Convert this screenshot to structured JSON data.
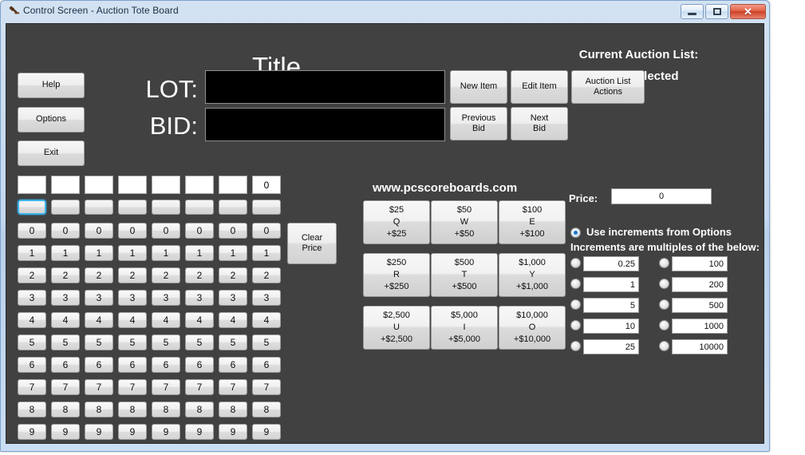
{
  "window": {
    "title": "Control Screen - Auction Tote Board",
    "icon": "gavel-icon",
    "minimize_label": "",
    "maximize_label": "",
    "close_label": "✕"
  },
  "header": {
    "app_title": "Title",
    "current_list_label": "Current Auction List:",
    "current_list_value": "none selected"
  },
  "left_buttons": [
    {
      "label": "Help",
      "name": "help-button"
    },
    {
      "label": "Options",
      "name": "options-button"
    },
    {
      "label": "Exit",
      "name": "exit-button"
    }
  ],
  "fields": {
    "lot_label": "LOT:",
    "lot_value": "",
    "bid_label": "BID:",
    "bid_value": ""
  },
  "item_buttons": [
    {
      "label": "New Item",
      "name": "new-item-button"
    },
    {
      "label": "Edit Item",
      "name": "edit-item-button"
    },
    {
      "label": "Auction List\nActions",
      "name": "auction-list-actions-button"
    },
    {
      "label": "Previous\nBid",
      "name": "previous-bid-button"
    },
    {
      "label": "Next\nBid",
      "name": "next-bid-button"
    }
  ],
  "keypad": {
    "columns": 8,
    "top_row_values": [
      "",
      "",
      "",
      "",
      "",
      "",
      "",
      "0"
    ],
    "blank_row_focused_index": 0,
    "digit_rows": [
      "0",
      "1",
      "2",
      "3",
      "4",
      "5",
      "6",
      "7",
      "8",
      "9"
    ],
    "clear_price_label": "Clear\nPrice"
  },
  "branding": {
    "website": "www.pcscoreboards.com"
  },
  "quick_amounts": [
    {
      "amount": "$25",
      "key": "Q",
      "delta": "+$25"
    },
    {
      "amount": "$50",
      "key": "W",
      "delta": "+$50"
    },
    {
      "amount": "$100",
      "key": "E",
      "delta": "+$100"
    },
    {
      "amount": "$250",
      "key": "R",
      "delta": "+$250"
    },
    {
      "amount": "$500",
      "key": "T",
      "delta": "+$500"
    },
    {
      "amount": "$1,000",
      "key": "Y",
      "delta": "+$1,000"
    },
    {
      "amount": "$2,500",
      "key": "U",
      "delta": "+$2,500"
    },
    {
      "amount": "$5,000",
      "key": "I",
      "delta": "+$5,000"
    },
    {
      "amount": "$10,000",
      "key": "O",
      "delta": "+$10,000"
    }
  ],
  "price_panel": {
    "price_label": "Price:",
    "price_value": "0",
    "use_options_label": "Use increments from Options",
    "use_options_selected": true,
    "multiples_label": "Increments are multiples of the below:",
    "left_column": [
      {
        "value": "0.25",
        "selected": false
      },
      {
        "value": "1",
        "selected": false
      },
      {
        "value": "5",
        "selected": false
      },
      {
        "value": "10",
        "selected": false
      },
      {
        "value": "25",
        "selected": false
      }
    ],
    "right_column": [
      {
        "value": "100",
        "selected": false
      },
      {
        "value": "200",
        "selected": false
      },
      {
        "value": "500",
        "selected": false
      },
      {
        "value": "1000",
        "selected": false
      },
      {
        "value": "10000",
        "selected": false
      }
    ]
  },
  "colors": {
    "app_background": "#414141",
    "focus_accent": "#38b3ea",
    "radio_accent": "#1a76c8",
    "display_background": "#000000",
    "titlebar_text": "#1b2c45"
  }
}
